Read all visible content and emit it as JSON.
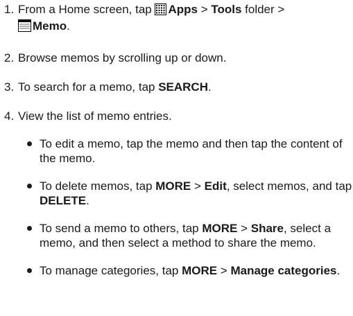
{
  "steps": [
    {
      "number": "1.",
      "parts": {
        "a": "From a Home screen, tap ",
        "b": "Apps",
        "c": " > ",
        "d": "Tools",
        "e": " folder > ",
        "f": "Memo",
        "g": "."
      },
      "icons": [
        "apps-grid-icon",
        "memo-icon"
      ]
    },
    {
      "number": "2.",
      "text": "Browse memos by scrolling up or down."
    },
    {
      "number": "3.",
      "a": "To search for a memo, tap ",
      "b": "SEARCH",
      "c": "."
    },
    {
      "number": "4.",
      "text": "View the list of memo entries."
    }
  ],
  "bullets": [
    {
      "text": "To edit a memo, tap the memo and then tap the content of the memo."
    },
    {
      "a": "To delete memos, tap ",
      "b": "MORE",
      "c": " > ",
      "d": "Edit",
      "e": ", select memos, and tap ",
      "f": "DELETE",
      "g": "."
    },
    {
      "a": "To send a memo to others, tap ",
      "b": "MORE",
      "c": " > ",
      "d": "Share",
      "e": ", select a memo, and then select a method to share the memo."
    },
    {
      "a": "To manage categories, tap ",
      "b": "MORE",
      "c": " > ",
      "d": "Manage categories",
      "e": "."
    }
  ]
}
